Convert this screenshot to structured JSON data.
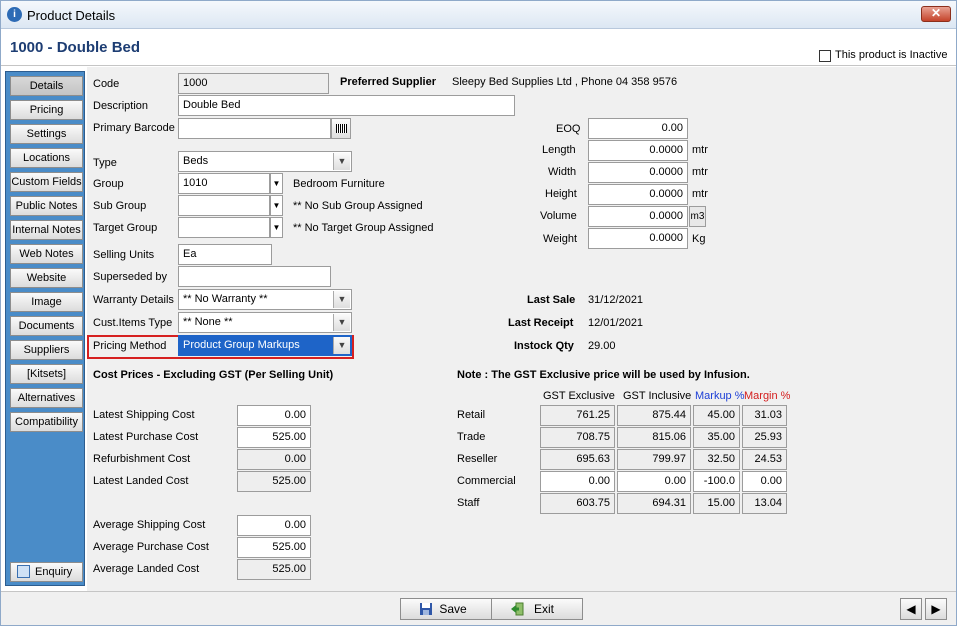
{
  "window": {
    "title": "Product Details",
    "close_symbol": "✕"
  },
  "header": {
    "product_title": "1000 - Double Bed",
    "inactive_label": "This product is Inactive"
  },
  "sidebar": {
    "items": [
      "Details",
      "Pricing",
      "Settings",
      "Locations",
      "Custom Fields",
      "Public Notes",
      "Internal Notes",
      "Web Notes",
      "Website",
      "Image",
      "Documents",
      "Suppliers",
      "[Kitsets]",
      "Alternatives",
      "Compatibility"
    ],
    "enquiry": "Enquiry"
  },
  "details": {
    "code_label": "Code",
    "code": "1000",
    "preferred_supplier_label": "Preferred Supplier",
    "preferred_supplier": "Sleepy Bed Supplies Ltd , Phone 04 358 9576",
    "description_label": "Description",
    "description": "Double Bed",
    "barcode_label": "Primary Barcode",
    "barcode": "",
    "type_label": "Type",
    "type": "Beds",
    "group_label": "Group",
    "group_code": "1010",
    "group_name": "Bedroom Furniture",
    "subgroup_label": "Sub Group",
    "subgroup_code": "",
    "subgroup_name": "** No Sub Group Assigned",
    "targetgroup_label": "Target Group",
    "targetgroup_code": "",
    "targetgroup_name": "** No Target Group Assigned",
    "selling_units_label": "Selling Units",
    "selling_units": "Ea",
    "superseded_label": "Superseded by",
    "superseded": "",
    "warranty_label": "Warranty Details",
    "warranty": "** No Warranty **",
    "custitems_label": "Cust.Items Type",
    "custitems": "** None **",
    "pricing_method_label": "Pricing Method",
    "pricing_method": "Product Group Markups"
  },
  "dimensions": {
    "eoq_label": "EOQ",
    "eoq": "0.00",
    "length_label": "Length",
    "length": "0.0000",
    "length_unit": "mtr",
    "width_label": "Width",
    "width": "0.0000",
    "width_unit": "mtr",
    "height_label": "Height",
    "height": "0.0000",
    "height_unit": "mtr",
    "volume_label": "Volume",
    "volume": "0.0000",
    "volume_unit": "m3",
    "weight_label": "Weight",
    "weight": "0.0000",
    "weight_unit": "Kg"
  },
  "stats": {
    "last_sale_label": "Last Sale",
    "last_sale": "31/12/2021",
    "last_receipt_label": "Last Receipt",
    "last_receipt": "12/01/2021",
    "instock_label": "Instock Qty",
    "instock": "29.00"
  },
  "costs": {
    "heading": "Cost Prices - Excluding GST (Per Selling Unit)",
    "rows": [
      {
        "label": "Latest Shipping Cost",
        "value": "0.00"
      },
      {
        "label": "Latest Purchase Cost",
        "value": "525.00"
      },
      {
        "label": "Refurbishment Cost",
        "value": "0.00"
      },
      {
        "label": "Latest Landed Cost",
        "value": "525.00"
      },
      {
        "label": "Average Shipping Cost",
        "value": "0.00"
      },
      {
        "label": "Average Purchase Cost",
        "value": "525.00"
      },
      {
        "label": "Average Landed Cost",
        "value": "525.00"
      }
    ]
  },
  "prices": {
    "note": "Note : The GST Exclusive price will be used by Infusion.",
    "headers": [
      "GST Exclusive",
      "GST Inclusive",
      "Markup %",
      "Margin %"
    ],
    "rows": [
      {
        "label": "Retail",
        "values": [
          "761.25",
          "875.44",
          "45.00",
          "31.03"
        ]
      },
      {
        "label": "Trade",
        "values": [
          "708.75",
          "815.06",
          "35.00",
          "25.93"
        ]
      },
      {
        "label": "Reseller",
        "values": [
          "695.63",
          "799.97",
          "32.50",
          "24.53"
        ]
      },
      {
        "label": "Commercial",
        "values": [
          "0.00",
          "0.00",
          "-100.0",
          "0.00"
        ]
      },
      {
        "label": "Staff",
        "values": [
          "603.75",
          "694.31",
          "15.00",
          "13.04"
        ]
      }
    ]
  },
  "footer": {
    "save": "Save",
    "exit": "Exit",
    "prev_symbol": "◀",
    "next_symbol": "▶"
  }
}
